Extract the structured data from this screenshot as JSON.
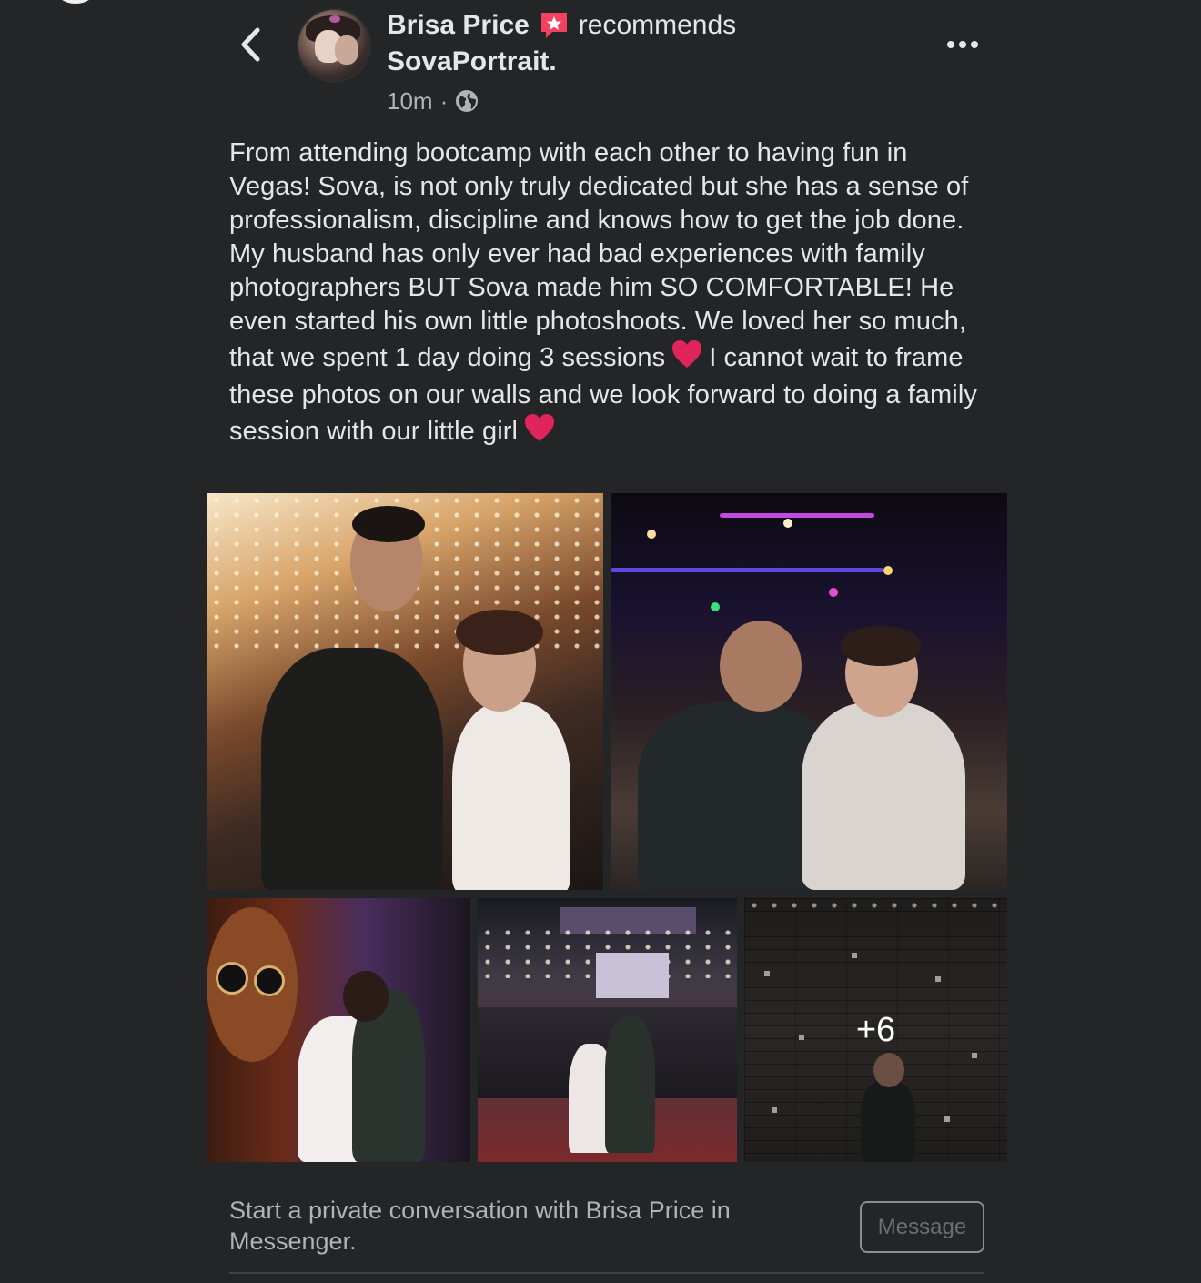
{
  "post": {
    "author": "Brisa Price",
    "verb": "recommends",
    "page_name": "SovaPortrait.",
    "time": "10m",
    "separator": "·",
    "body_parts": [
      "From attending bootcamp with each other to having fun in Vegas! Sova, is not only truly dedicated but she has a sense of professionalism, discipline and knows how to get the job done. My husband has only ever had bad experiences with family photographers BUT Sova made him SO COMFORTABLE! He even started his own little photoshoots. We loved her so much, that we spent 1 day doing 3 sessions",
      "I cannot wait to frame these photos on our walls and we look forward to doing a family session with our little girl"
    ],
    "more_photos_label": "+6",
    "icons": {
      "back": "chevron-left-icon",
      "recommend": "recommend-star-icon",
      "audience": "globe-icon",
      "more": "more-options-icon",
      "heart": "red-heart-emoji"
    }
  },
  "footer": {
    "cta_text": "Start a private conversation with Brisa Price in Messenger.",
    "message_button": "Message"
  },
  "colors": {
    "background": "#242526",
    "text_primary": "#e4e6eb",
    "text_secondary": "#b0b3b8",
    "recommend_badge": "#f3425f",
    "heart": "#e0245e"
  }
}
